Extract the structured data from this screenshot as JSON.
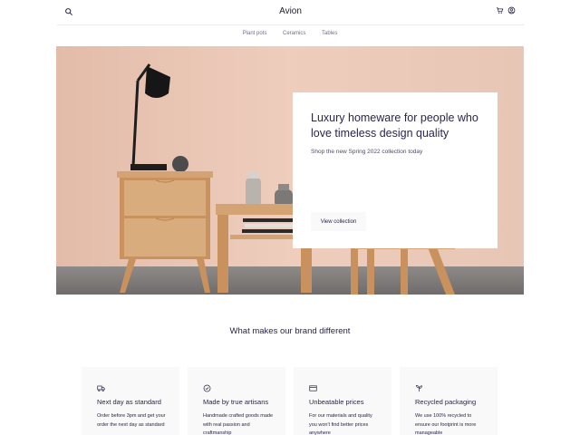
{
  "header": {
    "brand": "Avion",
    "icons": [
      "search-icon",
      "cart-icon",
      "user-icon"
    ]
  },
  "nav": {
    "items": [
      {
        "label": "Plant pots"
      },
      {
        "label": "Ceramics"
      },
      {
        "label": "Tables"
      }
    ]
  },
  "hero": {
    "title": "Luxury homeware for people who love timeless design quality",
    "subtitle": "Shop the new Spring 2022 collection today",
    "button_label": "View collection",
    "background_color": "#E5C4B3"
  },
  "features": {
    "title": "What makes our brand different",
    "items": [
      {
        "icon": "delivery-truck-icon",
        "title": "Next day as standard",
        "description": "Order before 3pm and get your order the next day as standard"
      },
      {
        "icon": "checkmark-circle-icon",
        "title": "Made by true artisans",
        "description": "Handmade crafted goods made with real passion and craftmanship"
      },
      {
        "icon": "credit-card-icon",
        "title": "Unbeatable prices",
        "description": "For our materials and quality you won't find better prices anywhere"
      },
      {
        "icon": "plant-icon",
        "title": "Recycled packaging",
        "description": "We use 100% recycled to ensure our footprint is more manageable"
      }
    ]
  },
  "colors": {
    "primary": "#2A254B",
    "muted": "#726E8D",
    "card_bg": "#F9F9F9"
  }
}
